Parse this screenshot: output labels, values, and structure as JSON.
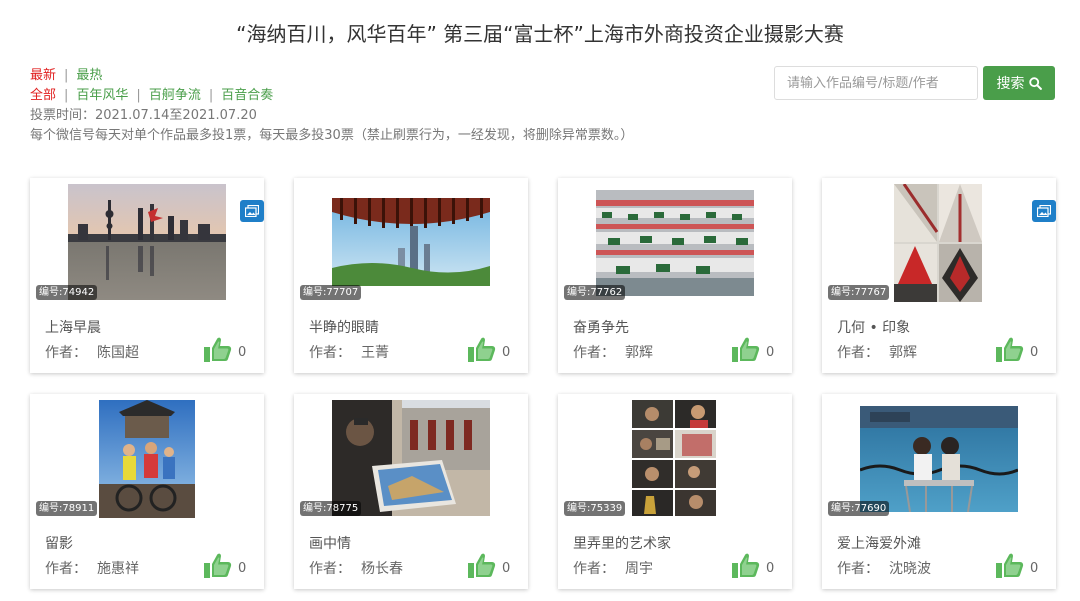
{
  "page": {
    "title": "“海纳百川，风华百年” 第三届“富士杯”上海市外商投资企业摄影大赛"
  },
  "sort": {
    "latest": "最新",
    "hottest": "最热"
  },
  "categories": [
    "全部",
    "百年风华",
    "百舸争流",
    "百音合奏"
  ],
  "vote_period": "投票时间：2021.07.14至2021.07.20",
  "vote_rule": "每个微信号每天对单个作品最多投1票，每天最多投30票（禁止刷票行为，一经发现，将删除异常票数。）",
  "search": {
    "placeholder": "请输入作品编号/标题/作者",
    "button_label": "搜索"
  },
  "colors": {
    "active": "#e02020",
    "link": "#4a9e4a",
    "search_button": "#4a9e4a",
    "like_icon": "#5cb85c",
    "multi_badge": "#1f7fc8"
  },
  "author_label": "作者：",
  "works": [
    {
      "id": "编号:74942",
      "title": "上海早晨",
      "author": "陈国超",
      "votes": "0",
      "multi": true
    },
    {
      "id": "编号:77707",
      "title": "半睁的眼睛",
      "author": "王菁",
      "votes": "0",
      "multi": false
    },
    {
      "id": "编号:77762",
      "title": "奋勇争先",
      "author": "郭辉",
      "votes": "0",
      "multi": false
    },
    {
      "id": "编号:77767",
      "title": "几何 • 印象",
      "author": "郭辉",
      "votes": "0",
      "multi": true
    },
    {
      "id": "编号:78911",
      "title": "留影",
      "author": "施惠祥",
      "votes": "0",
      "multi": false
    },
    {
      "id": "编号:78775",
      "title": "画中情",
      "author": "杨长春",
      "votes": "0",
      "multi": false
    },
    {
      "id": "编号:75339",
      "title": "里弄里的艺术家",
      "author": "周宇",
      "votes": "0",
      "multi": false
    },
    {
      "id": "编号:77690",
      "title": "爱上海爱外滩",
      "author": "沈晓波",
      "votes": "0",
      "multi": false
    }
  ]
}
